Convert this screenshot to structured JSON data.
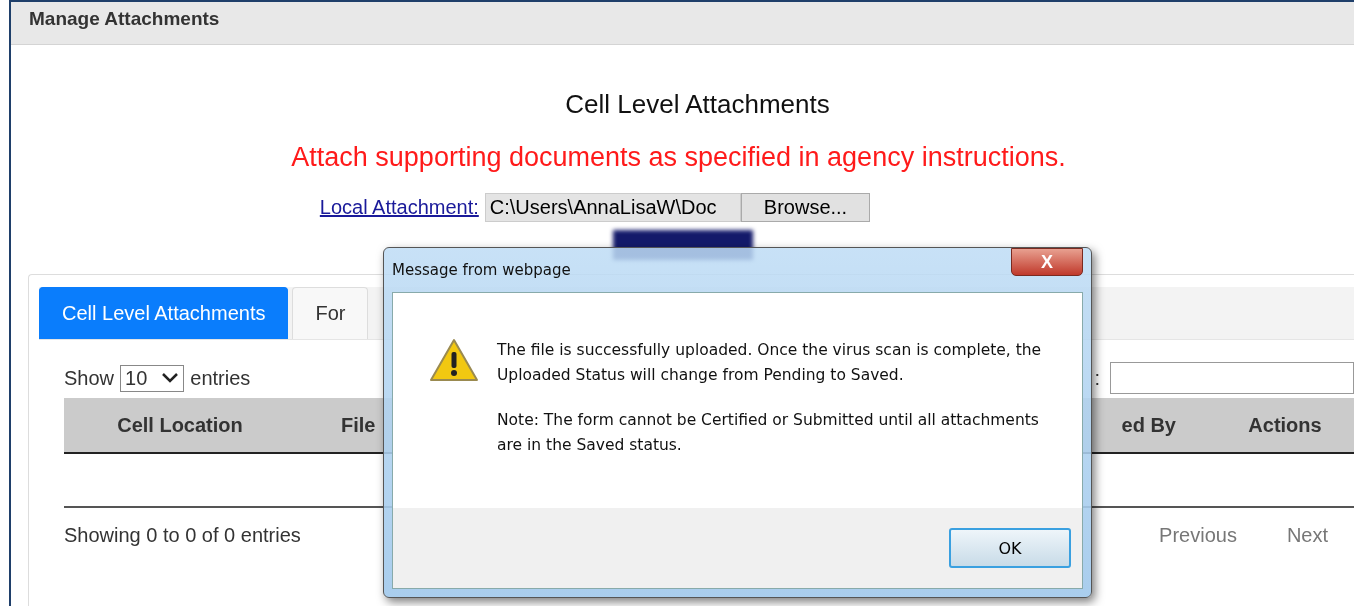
{
  "page": {
    "title": "Manage Attachments",
    "heading": "Cell Level Attachments",
    "instruction": "Attach supporting documents as specified in agency instructions.",
    "local_attachment": {
      "label": "Local Attachment:",
      "value": "C:\\Users\\AnnaLisaW\\Doc",
      "browse": "Browse..."
    }
  },
  "tabs": [
    {
      "label": "Cell Level Attachments",
      "selected": true
    },
    {
      "label": "For",
      "selected": false
    }
  ],
  "table": {
    "length_label": "Show",
    "length_value": "10",
    "length_suffix": "entries",
    "search_label": ":",
    "columns": [
      "Cell Location",
      "File",
      "ed By",
      "Actions"
    ],
    "info": "Showing 0 to 0 of 0 entries",
    "pagination": [
      {
        "label": "Previous",
        "disabled": true
      },
      {
        "label": "Next",
        "disabled": true
      }
    ]
  },
  "dialog": {
    "title": "Message from webpage",
    "close": "X",
    "message": "The file is successfully uploaded. Once the virus scan is complete, the Uploaded Status will change from Pending to Saved.",
    "note": "Note: The form cannot be Certified or Submitted until all attachments are in the Saved status.",
    "ok": "OK"
  }
}
